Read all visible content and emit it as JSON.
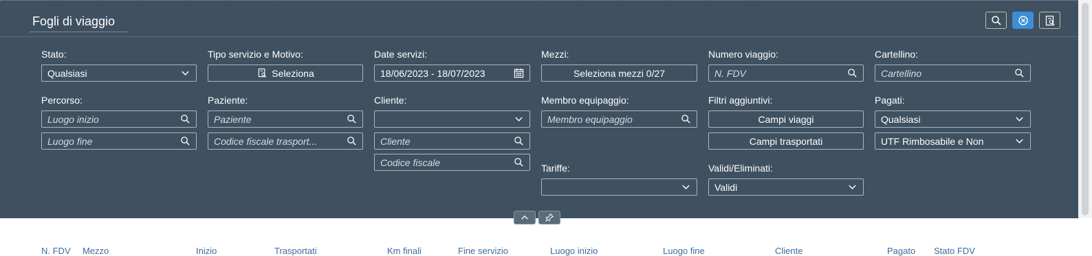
{
  "page": {
    "title": "Fogli di viaggio"
  },
  "toolbar": {
    "icons": [
      "search-icon",
      "clear-filter-icon",
      "report-icon"
    ]
  },
  "filters": {
    "stato": {
      "label": "Stato:",
      "value": "Qualsiasi"
    },
    "tipo_servizio": {
      "label": "Tipo servizio e Motivo:",
      "button": "Seleziona"
    },
    "date_servizi": {
      "label": "Date servizi:",
      "value": "18/06/2023 - 18/07/2023"
    },
    "mezzi": {
      "label": "Mezzi:",
      "button": "Seleziona mezzi 0/27"
    },
    "numero_viaggio": {
      "label": "Numero viaggio:",
      "placeholder": "N. FDV"
    },
    "cartellino": {
      "label": "Cartellino:",
      "placeholder": "Cartellino"
    },
    "percorso": {
      "label": "Percorso:",
      "start_placeholder": "Luogo inizio",
      "end_placeholder": "Luogo fine"
    },
    "paziente": {
      "label": "Paziente:",
      "placeholder": "Paziente",
      "cf_placeholder": "Codice fiscale trasport..."
    },
    "cliente": {
      "label": "Cliente:",
      "value": "",
      "placeholder": "Cliente",
      "cf_placeholder": "Codice fiscale"
    },
    "membro": {
      "label": "Membro equipaggio:",
      "placeholder": "Membro equipaggio"
    },
    "filtri_agg": {
      "label": "Filtri aggiuntivi:",
      "btn1": "Campi viaggi",
      "btn2": "Campi trasportati"
    },
    "pagati": {
      "label": "Pagati:",
      "value": "Qualsiasi",
      "value2": "UTF Rimbosabile e Non"
    },
    "tariffe": {
      "label": "Tariffe:",
      "value": ""
    },
    "validi": {
      "label": "Validi/Eliminati:",
      "value": "Validi"
    }
  },
  "table": {
    "columns": [
      "N. FDV",
      "Mezzo",
      "Inizio",
      "Trasportati",
      "Km finali",
      "Fine servizio",
      "Luogo inizio",
      "Luogo fine",
      "Cliente",
      "Pagato",
      "Stato FDV"
    ]
  },
  "colors": {
    "bar": "#3f5161",
    "border": "#a9b7c4",
    "accent": "#3c8fd6"
  }
}
